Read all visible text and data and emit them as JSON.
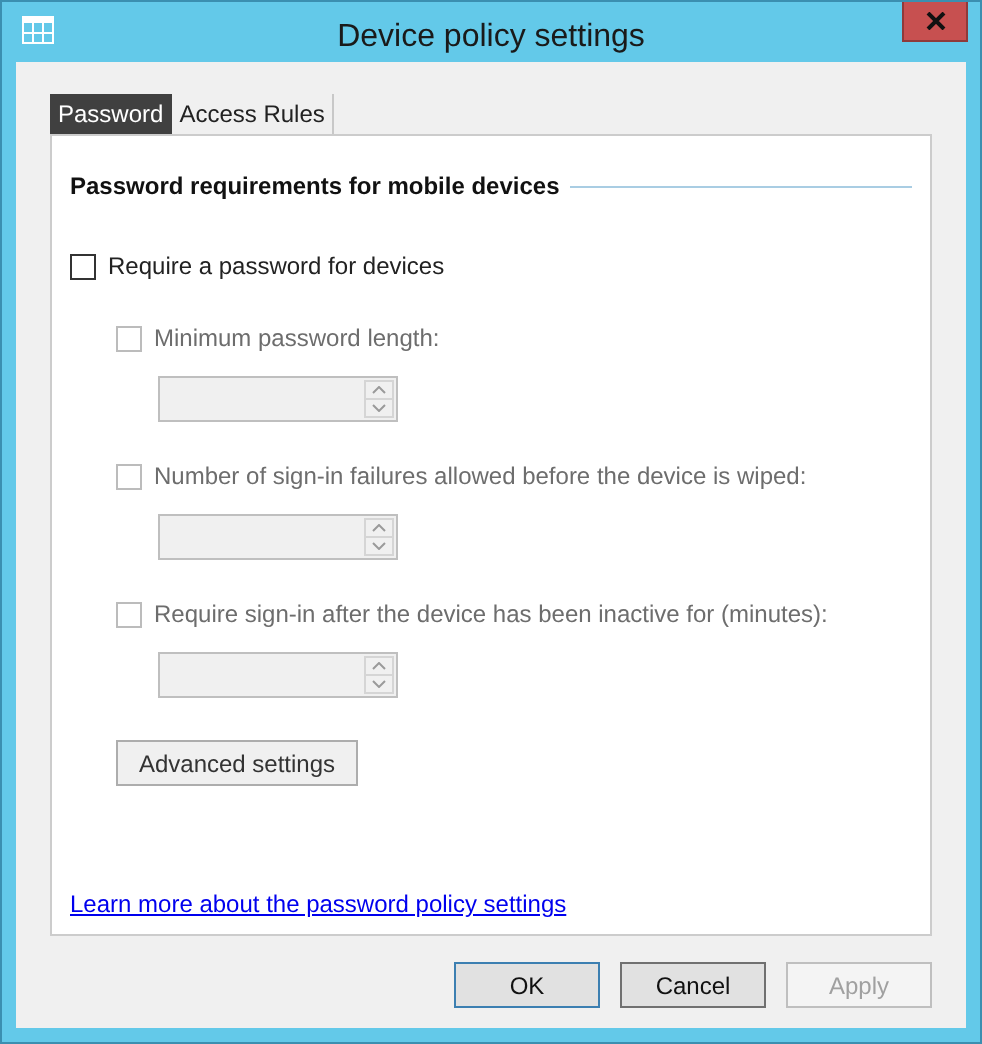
{
  "window": {
    "title": "Device policy settings"
  },
  "tabs": [
    {
      "label": "Password",
      "selected": true
    },
    {
      "label": "Access Rules",
      "selected": false
    }
  ],
  "section": {
    "heading": "Password requirements for mobile devices"
  },
  "require_password": {
    "label": "Require a password for devices",
    "checked": false
  },
  "options": [
    {
      "label": "Minimum password length:",
      "checked": false,
      "disabled": true,
      "field": {
        "disabled": true
      }
    },
    {
      "label": "Number of sign-in failures allowed before the device is wiped:",
      "checked": false,
      "disabled": true,
      "field": {
        "disabled": true
      }
    },
    {
      "label": "Require sign-in after the device has been inactive for (minutes):",
      "checked": false,
      "disabled": true,
      "field": {
        "disabled": true
      }
    }
  ],
  "advanced_button": {
    "label": "Advanced settings",
    "disabled": false
  },
  "link": "Learn more about the password policy settings",
  "buttons": [
    {
      "label": "OK",
      "default": true,
      "disabled": false
    },
    {
      "label": "Cancel",
      "default": false,
      "disabled": false
    },
    {
      "label": "Apply",
      "default": false,
      "disabled": true
    }
  ]
}
